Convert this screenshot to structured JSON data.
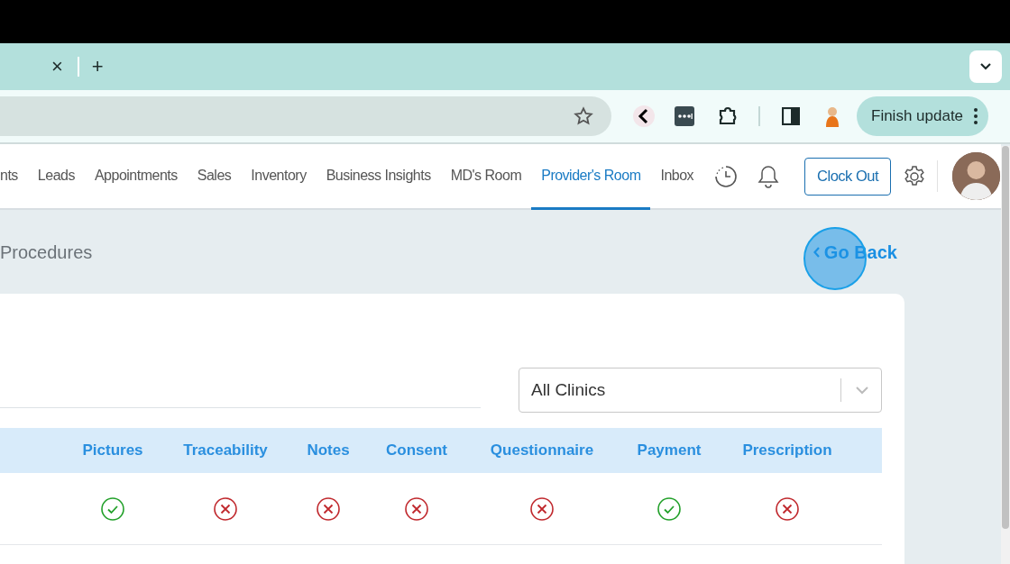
{
  "browser": {
    "tab_close": "×",
    "new_tab": "+",
    "finish_update": "Finish update"
  },
  "nav": {
    "items": [
      {
        "label": "nts",
        "selected": false
      },
      {
        "label": "Leads",
        "selected": false
      },
      {
        "label": "Appointments",
        "selected": false
      },
      {
        "label": "Sales",
        "selected": false
      },
      {
        "label": "Inventory",
        "selected": false
      },
      {
        "label": "Business Insights",
        "selected": false
      },
      {
        "label": "MD's Room",
        "selected": false
      },
      {
        "label": "Provider's Room",
        "selected": true
      },
      {
        "label": "Inbox",
        "selected": false
      }
    ],
    "clock_out": "Clock Out"
  },
  "page": {
    "title": "Procedures",
    "back": "Go Back"
  },
  "filter": {
    "value": "All Clinics"
  },
  "table": {
    "columns": [
      "Pictures",
      "Traceability",
      "Notes",
      "Consent",
      "Questionnaire",
      "Payment",
      "Prescription"
    ],
    "rows": [
      {
        "cells": [
          {
            "complete": true
          },
          {
            "complete": false
          },
          {
            "complete": false
          },
          {
            "complete": false
          },
          {
            "complete": false
          },
          {
            "complete": true
          },
          {
            "complete": false
          }
        ]
      }
    ]
  }
}
